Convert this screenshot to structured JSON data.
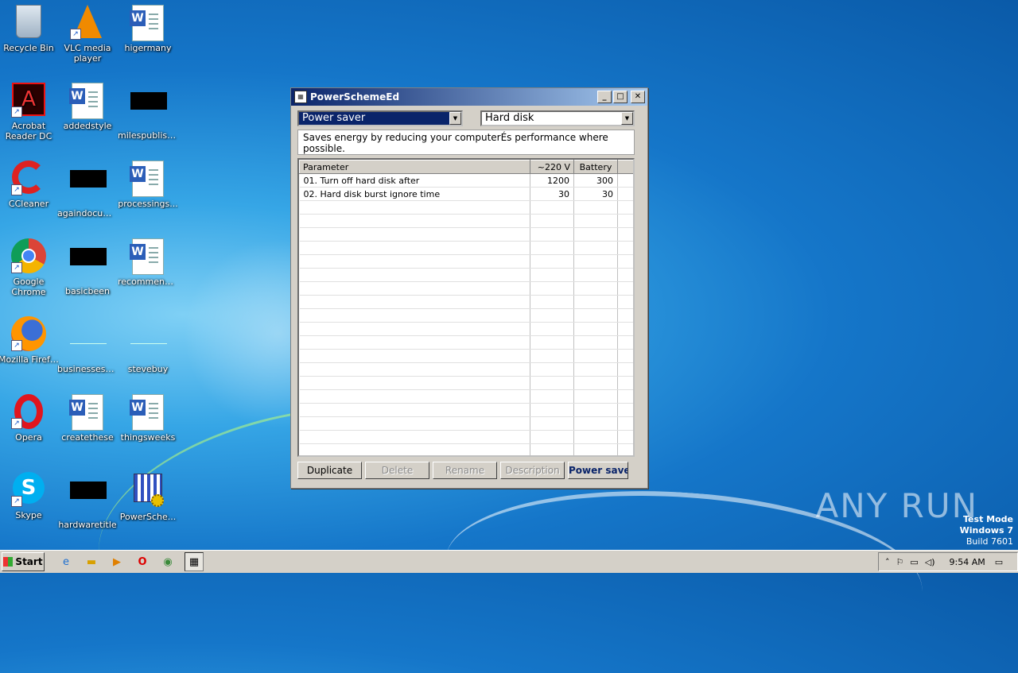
{
  "desktop_icons": [
    {
      "label": "Recycle Bin"
    },
    {
      "label": "VLC media player"
    },
    {
      "label": "higermany"
    },
    {
      "label": "Acrobat Reader DC"
    },
    {
      "label": "addedstyle"
    },
    {
      "label": "milespublisher"
    },
    {
      "label": "CCleaner"
    },
    {
      "label": "againdocum..."
    },
    {
      "label": "processings..."
    },
    {
      "label": "Google Chrome"
    },
    {
      "label": "basicbeen"
    },
    {
      "label": "recommend..."
    },
    {
      "label": "Mozilla Firefox"
    },
    {
      "label": "businessesb..."
    },
    {
      "label": "stevebuy"
    },
    {
      "label": "Opera"
    },
    {
      "label": "createthese"
    },
    {
      "label": "thingsweeks"
    },
    {
      "label": "Skype"
    },
    {
      "label": "hardwaretitle"
    },
    {
      "label": "PowerSche..."
    }
  ],
  "window": {
    "title": "PowerSchemeEd",
    "scheme_combo": "Power saver",
    "category_combo": "Hard disk",
    "description": "Saves energy by reducing your computerÉs performance where possible.",
    "columns": [
      "Parameter",
      "~220 V",
      "Battery"
    ],
    "rows": [
      {
        "param": "01. Turn off hard disk after",
        "ac": "1200",
        "battery": "300"
      },
      {
        "param": "02. Hard disk burst ignore time",
        "ac": "30",
        "battery": "30"
      }
    ],
    "buttons": {
      "duplicate": "Duplicate",
      "delete": "Delete",
      "rename": "Rename",
      "description": "Description",
      "active": "Power saver"
    }
  },
  "taskbar": {
    "start": "Start",
    "clock": "9:54 AM"
  },
  "watermark": {
    "brand": "ANY RUN",
    "line1": "Test Mode",
    "line2": "Windows 7",
    "line3": "Build 7601"
  }
}
